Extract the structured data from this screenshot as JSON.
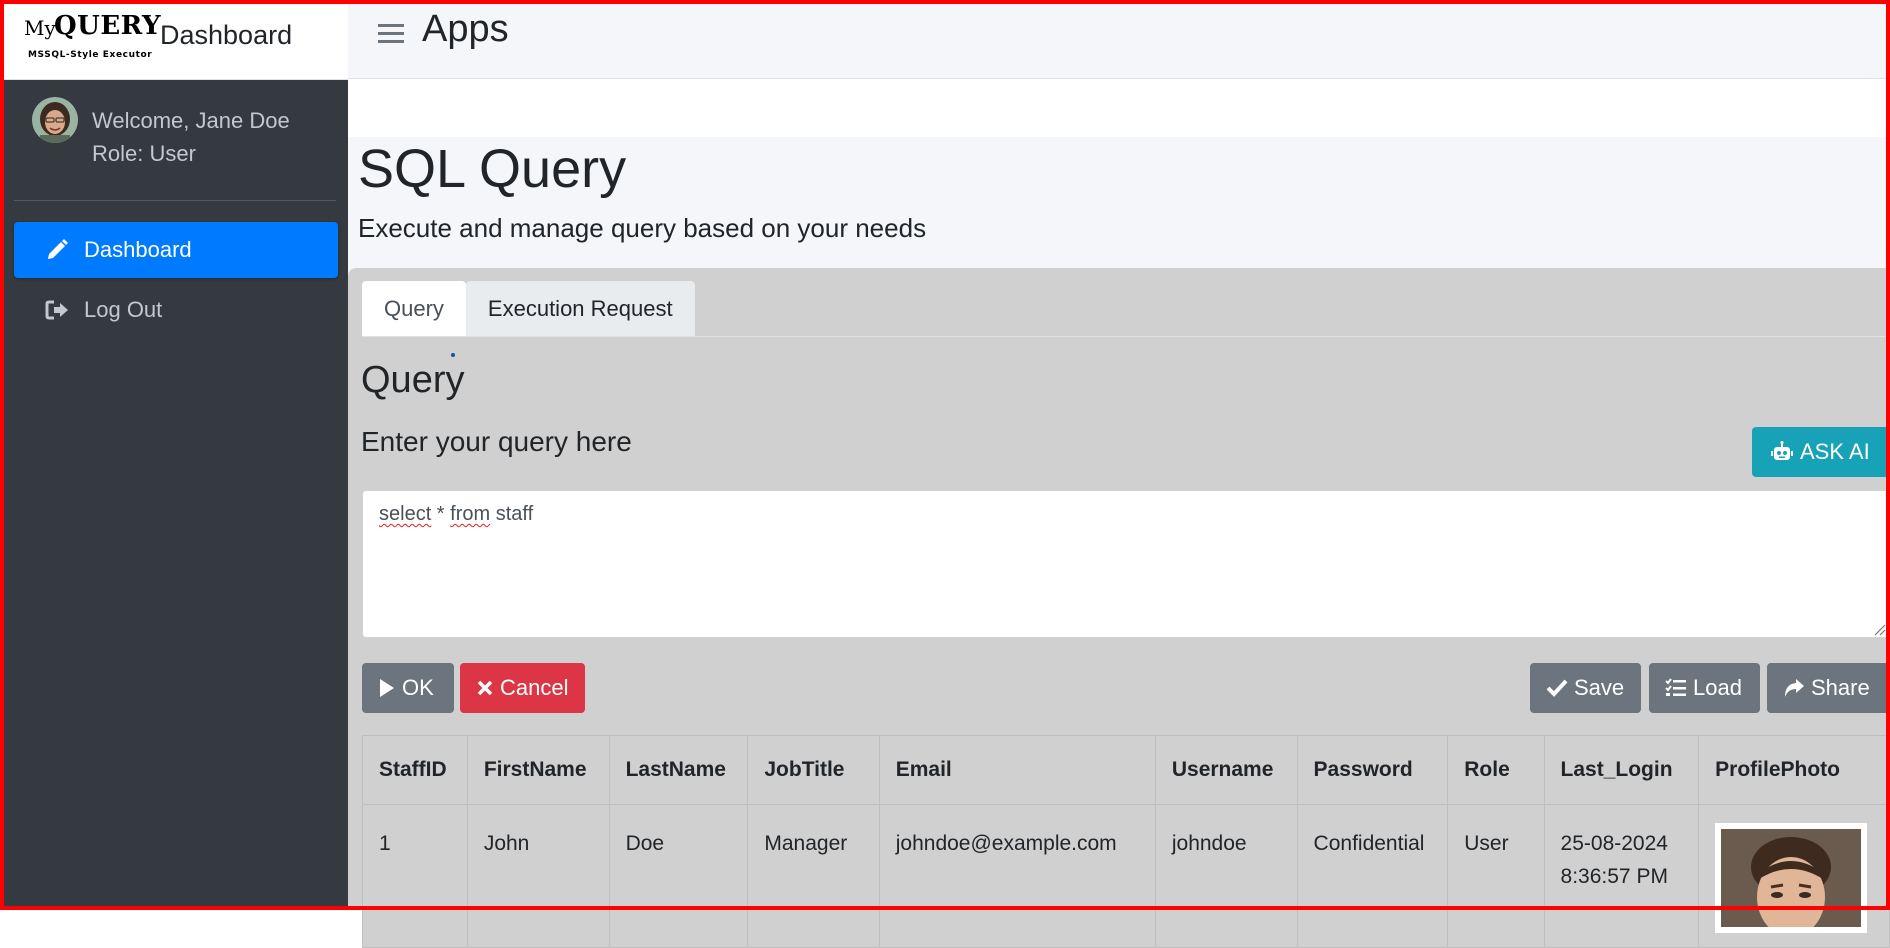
{
  "brand": {
    "my": "My",
    "query": "QUERY",
    "subtitle": "MSSQL-Style Executor",
    "title": "Dashboard"
  },
  "user": {
    "welcome": "Welcome, Jane Doe",
    "role": "Role: User"
  },
  "nav": {
    "items": [
      {
        "label": "Dashboard",
        "icon": "pencil-icon",
        "active": true
      },
      {
        "label": "Log Out",
        "icon": "sign-out-icon",
        "active": false
      }
    ]
  },
  "header": {
    "title": "Apps"
  },
  "page": {
    "title": "SQL Query",
    "subtitle": "Execute and manage query based on your needs"
  },
  "tabs": [
    {
      "label": "Query",
      "active": true
    },
    {
      "label": "Execution Request",
      "active": false
    }
  ],
  "query_section": {
    "title": "Query",
    "subtitle": "Enter your query here",
    "ask_ai_label": "ASK AI",
    "query_text": {
      "w1": "select",
      "w2": " * ",
      "w3": "from",
      "w4": " staff"
    }
  },
  "actions": {
    "ok_label": "OK",
    "cancel_label": "Cancel",
    "save_label": "Save",
    "load_label": "Load",
    "share_label": "Share"
  },
  "table": {
    "headers": [
      "StaffID",
      "FirstName",
      "LastName",
      "JobTitle",
      "Email",
      "Username",
      "Password",
      "Role",
      "Last_Login",
      "ProfilePhoto"
    ],
    "rows": [
      {
        "staff_id": "1",
        "first_name": "John",
        "last_name": "Doe",
        "job_title": "Manager",
        "email": "johndoe@example.com",
        "username": "johndoe",
        "password": "Confidential",
        "role": "User",
        "last_login_date": "25-08-2024",
        "last_login_time": "8:36:57 PM"
      }
    ]
  },
  "colors": {
    "sidebar": "#343a40",
    "primary": "#007bff",
    "info": "#17a2b8",
    "danger": "#dc3545",
    "secondary": "#6c757d",
    "frame": "#ff0000"
  }
}
